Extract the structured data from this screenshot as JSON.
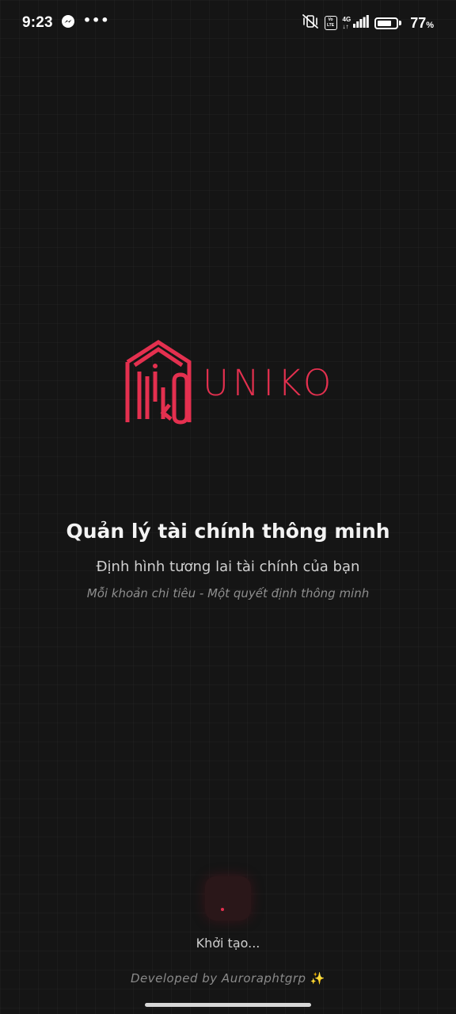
{
  "status_bar": {
    "time": "9:23",
    "more_indicator": "•••",
    "volte_label": "Vo LTE",
    "network_label": "4G",
    "network_sub": "↓↑",
    "battery_percent": "77",
    "battery_unit": "%",
    "battery_level": 0.77,
    "icons": [
      "messenger-icon",
      "mute-vibrate-icon",
      "volte-icon",
      "signal-icon",
      "battery-icon"
    ]
  },
  "app": {
    "name": "UNIKO",
    "brand_color": "#e4304f"
  },
  "splash": {
    "headline": "Quản lý tài chính thông minh",
    "subtitle": "Định hình tương lai tài chính của bạn",
    "tagline": "Mỗi khoản chi tiêu - Một quyết định thông minh",
    "loading_text": "Khởi tạo...",
    "developer_credit": "Developed by Auroraphtgrp",
    "developer_emoji": "✨"
  }
}
